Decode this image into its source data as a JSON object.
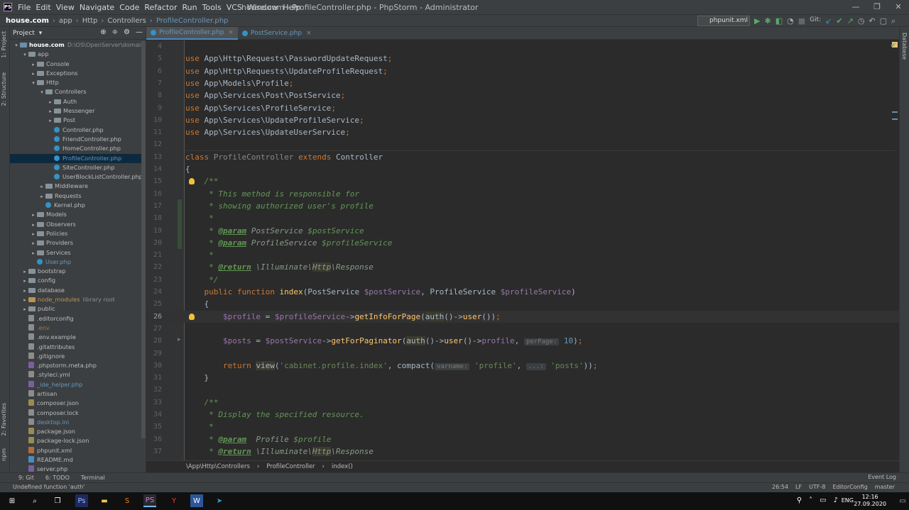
{
  "window": {
    "title": "house.com - ProfileController.php - PhpStorm - Administrator",
    "logo": "PS",
    "controls": [
      "—",
      "❐",
      "✕"
    ]
  },
  "menu": [
    "File",
    "Edit",
    "View",
    "Navigate",
    "Code",
    "Refactor",
    "Run",
    "Tools",
    "VCS",
    "Window",
    "Help"
  ],
  "navbar": {
    "crumbs": [
      "house.com",
      "app",
      "Http",
      "Controllers",
      "ProfileController.php"
    ],
    "run_config": "phpunit.xml",
    "git_label": "Git:"
  },
  "left_strip": {
    "labels": [
      "1: Project",
      "2: Structure",
      "2: Favorites",
      "npm"
    ]
  },
  "right_strip": {
    "label": "Database"
  },
  "project": {
    "title": "Project",
    "tree": [
      {
        "name": "house.com",
        "extra": "D:\\OS\\OpenServer\\domains\\house",
        "indent": 0,
        "type": "root",
        "arrow": "▾"
      },
      {
        "name": "app",
        "indent": 1,
        "type": "folder",
        "arrow": "▾"
      },
      {
        "name": "Console",
        "indent": 2,
        "type": "folder",
        "arrow": "▸"
      },
      {
        "name": "Exceptions",
        "indent": 2,
        "type": "folder",
        "arrow": "▸"
      },
      {
        "name": "Http",
        "indent": 2,
        "type": "folder",
        "arrow": "▾"
      },
      {
        "name": "Controllers",
        "indent": 3,
        "type": "folder",
        "arrow": "▾"
      },
      {
        "name": "Auth",
        "indent": 4,
        "type": "folder",
        "arrow": "▸"
      },
      {
        "name": "Messenger",
        "indent": 4,
        "type": "folder",
        "arrow": "▸"
      },
      {
        "name": "Post",
        "indent": 4,
        "type": "folder",
        "arrow": "▸"
      },
      {
        "name": "Controller.php",
        "indent": 4,
        "type": "class"
      },
      {
        "name": "FriendController.php",
        "indent": 4,
        "type": "class"
      },
      {
        "name": "HomeController.php",
        "indent": 4,
        "type": "class"
      },
      {
        "name": "ProfileController.php",
        "indent": 4,
        "type": "class",
        "selected": true
      },
      {
        "name": "SiteController.php",
        "indent": 4,
        "type": "class"
      },
      {
        "name": "UserBlockListController.php",
        "indent": 4,
        "type": "class"
      },
      {
        "name": "Middleware",
        "indent": 3,
        "type": "folder",
        "arrow": "▸"
      },
      {
        "name": "Requests",
        "indent": 3,
        "type": "folder",
        "arrow": "▸"
      },
      {
        "name": "Kernel.php",
        "indent": 3,
        "type": "class"
      },
      {
        "name": "Models",
        "indent": 2,
        "type": "folder",
        "arrow": "▸"
      },
      {
        "name": "Observers",
        "indent": 2,
        "type": "folder",
        "arrow": "▸"
      },
      {
        "name": "Policies",
        "indent": 2,
        "type": "folder",
        "arrow": "▸"
      },
      {
        "name": "Providers",
        "indent": 2,
        "type": "folder",
        "arrow": "▸"
      },
      {
        "name": "Services",
        "indent": 2,
        "type": "folder",
        "arrow": "▸"
      },
      {
        "name": "User.php",
        "indent": 2,
        "type": "class",
        "blue": true
      },
      {
        "name": "bootstrap",
        "indent": 1,
        "type": "folder",
        "arrow": "▸"
      },
      {
        "name": "config",
        "indent": 1,
        "type": "folder",
        "arrow": "▸"
      },
      {
        "name": "database",
        "indent": 1,
        "type": "folder",
        "arrow": "▸"
      },
      {
        "name": "node_modules",
        "extra": "library root",
        "indent": 1,
        "type": "folder-orange",
        "arrow": "▸",
        "orange": true
      },
      {
        "name": "public",
        "indent": 1,
        "type": "folder",
        "arrow": "▸"
      },
      {
        "name": ".editorconfig",
        "indent": 1,
        "type": "file"
      },
      {
        "name": ".env",
        "indent": 1,
        "type": "file",
        "muted": true
      },
      {
        "name": ".env.example",
        "indent": 1,
        "type": "file"
      },
      {
        "name": ".gitattributes",
        "indent": 1,
        "type": "file"
      },
      {
        "name": ".gitignore",
        "indent": 1,
        "type": "file"
      },
      {
        "name": ".phpstorm.meta.php",
        "indent": 1,
        "type": "php"
      },
      {
        "name": ".styleci.yml",
        "indent": 1,
        "type": "file"
      },
      {
        "name": "_ide_helper.php",
        "indent": 1,
        "type": "php",
        "blue": true
      },
      {
        "name": "artisan",
        "indent": 1,
        "type": "file"
      },
      {
        "name": "composer.json",
        "indent": 1,
        "type": "json"
      },
      {
        "name": "composer.lock",
        "indent": 1,
        "type": "file"
      },
      {
        "name": "desktop.ini",
        "indent": 1,
        "type": "file",
        "blue": true
      },
      {
        "name": "package.json",
        "indent": 1,
        "type": "json"
      },
      {
        "name": "package-lock.json",
        "indent": 1,
        "type": "json"
      },
      {
        "name": "phpunit.xml",
        "indent": 1,
        "type": "xml"
      },
      {
        "name": "README.md",
        "indent": 1,
        "type": "md"
      },
      {
        "name": "server.php",
        "indent": 1,
        "type": "php"
      }
    ]
  },
  "tabs": [
    {
      "label": "ProfileController.php",
      "active": true
    },
    {
      "label": "PostService.php",
      "active": false
    }
  ],
  "editor": {
    "lines": [
      {
        "n": "4",
        "html": ""
      },
      {
        "n": "5",
        "html": "<span class=\"kw\">use</span> App\\Http\\Requests\\PasswordUpdateRequest<span class=\"kw\">;</span>"
      },
      {
        "n": "6",
        "html": "<span class=\"kw\">use</span> App\\Http\\Requests\\UpdateProfileRequest<span class=\"kw\">;</span>"
      },
      {
        "n": "7",
        "html": "<span class=\"kw\">use</span> App\\Models\\Profile<span class=\"kw\">;</span>"
      },
      {
        "n": "8",
        "html": "<span class=\"kw\">use</span> App\\Services\\Post\\PostService<span class=\"kw\">;</span>"
      },
      {
        "n": "9",
        "html": "<span class=\"kw\">use</span> App\\Services\\ProfileService<span class=\"kw\">;</span>"
      },
      {
        "n": "10",
        "html": "<span class=\"kw\">use</span> App\\Services\\UpdateProfileService<span class=\"kw\">;</span>"
      },
      {
        "n": "11",
        "html": "<span class=\"kw\">use</span> App\\Services\\UpdateUserService<span class=\"kw\">;</span>"
      },
      {
        "n": "12",
        "html": ""
      },
      {
        "n": "13",
        "html": "<span class=\"kw\">class</span> <span style=\"color:#888\">ProfileController</span> <span class=\"kw\">extends</span> Controller"
      },
      {
        "n": "14",
        "html": "{"
      },
      {
        "n": "15",
        "html": "    <span class=\"cmt\">/**</span>"
      },
      {
        "n": "16",
        "html": "<span class=\"cmt\">     * This method is responsible for</span>"
      },
      {
        "n": "17",
        "html": "<span class=\"cmt\">     * showing authorized user's profile</span>"
      },
      {
        "n": "18",
        "html": "<span class=\"cmt\">     *</span>"
      },
      {
        "n": "19",
        "html": "<span class=\"cmt\">     * </span><span class=\"tag\">@param</span><span class=\"cmt-type\"> PostService </span><span class=\"cmt\">$postService</span>"
      },
      {
        "n": "20",
        "html": "<span class=\"cmt\">     * </span><span class=\"tag\">@param</span><span class=\"cmt-type\"> ProfileService </span><span class=\"cmt\">$profileService</span>"
      },
      {
        "n": "21",
        "html": "<span class=\"cmt\">     *</span>"
      },
      {
        "n": "22",
        "html": "<span class=\"cmt\">     * </span><span class=\"tag\">@return</span><span class=\"cmt-type\"> \\Illuminate\\<span class=\"hl\">Http</span>\\Response</span>"
      },
      {
        "n": "23",
        "html": "<span class=\"cmt\">     */</span>"
      },
      {
        "n": "24",
        "html": "    <span class=\"kw\">public function</span> <span class=\"fn\">index</span>(PostService <span class=\"var\">$postService</span>, ProfileService <span class=\"var\">$profileService</span>)"
      },
      {
        "n": "25",
        "html": "    {"
      },
      {
        "n": "26",
        "html": "        <span class=\"var\">$profile</span> = <span class=\"var\">$profileService</span>-&gt;<span class=\"fn\">getInfoForPage</span>(<span class=\"hl\">auth</span>()-&gt;<span class=\"fn\">user</span>())<span class=\"kw\">;</span>",
        "current": true
      },
      {
        "n": "27",
        "html": ""
      },
      {
        "n": "28",
        "html": "        <span class=\"var\">$posts</span> = <span class=\"var\">$postService</span>-&gt;<span class=\"fn\">getForPaginator</span>(<span class=\"hl\">auth</span>()-&gt;<span class=\"fn\">user</span>()-&gt;<span class=\"var\">profile</span>, <span class=\"hint\">perPage:</span> <span style=\"color:#6897bb\">10</span>)<span class=\"kw\">;</span>"
      },
      {
        "n": "29",
        "html": ""
      },
      {
        "n": "30",
        "html": "        <span class=\"kw\">return</span> <span class=\"hl\">view</span>(<span class=\"str\">'cabinet.profile.index'</span>, compact(<span class=\"hint\">varname:</span> <span class=\"str\">'profile'</span>, <span class=\"hint\">...:</span> <span class=\"str\">'posts'</span>))<span class=\"kw\">;</span>"
      },
      {
        "n": "31",
        "html": "    }"
      },
      {
        "n": "32",
        "html": ""
      },
      {
        "n": "33",
        "html": "    <span class=\"cmt\">/**</span>"
      },
      {
        "n": "34",
        "html": "<span class=\"cmt\">     * Display the specified resource.</span>"
      },
      {
        "n": "35",
        "html": "<span class=\"cmt\">     *</span>"
      },
      {
        "n": "36",
        "html": "<span class=\"cmt\">     * </span><span class=\"tag\">@param</span><span class=\"cmt-type\">  Profile </span><span class=\"cmt\">$profile</span>"
      },
      {
        "n": "37",
        "html": "<span class=\"cmt\">     * </span><span class=\"tag\">@return</span><span class=\"cmt-type\"> \\Illuminate\\<span class=\"hl\">Http</span>\\Response</span>"
      }
    ]
  },
  "editor_breadcrumb": [
    "\\App\\Http\\Controllers",
    "ProfileController",
    "index()"
  ],
  "toolwindows": {
    "items": [
      "9: Git",
      "6: TODO",
      "Terminal"
    ],
    "event_log": "Event Log"
  },
  "status": {
    "message": "Undefined function 'auth'",
    "position": "26:54",
    "line_sep": "LF",
    "encoding": "UTF-8",
    "editorconfig": "EditorConfig",
    "branch": "master"
  },
  "taskbar": {
    "lang": "ENG",
    "time": "12:16",
    "date": "27.09.2020"
  }
}
